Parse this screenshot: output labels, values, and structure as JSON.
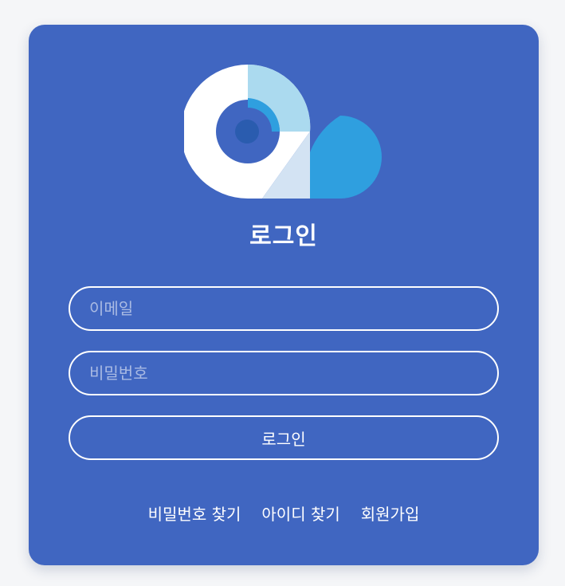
{
  "login": {
    "title": "로그인",
    "email_placeholder": "이메일",
    "password_placeholder": "비밀번호",
    "submit_label": "로그인"
  },
  "links": {
    "find_password": "비밀번호 찾기",
    "find_id": "아이디 찾기",
    "sign_up": "회원가입"
  },
  "colors": {
    "page_background": "#f5f6f8",
    "card_background": "#4066c1",
    "logo_light_blue": "#abdaef",
    "logo_mid_blue": "#2f9fdf",
    "logo_pale_blue": "#d3e3f3",
    "logo_core_blue": "#2a5caf",
    "text": "#ffffff"
  },
  "icons": {
    "logo": "cloud-ring-logo-icon"
  }
}
